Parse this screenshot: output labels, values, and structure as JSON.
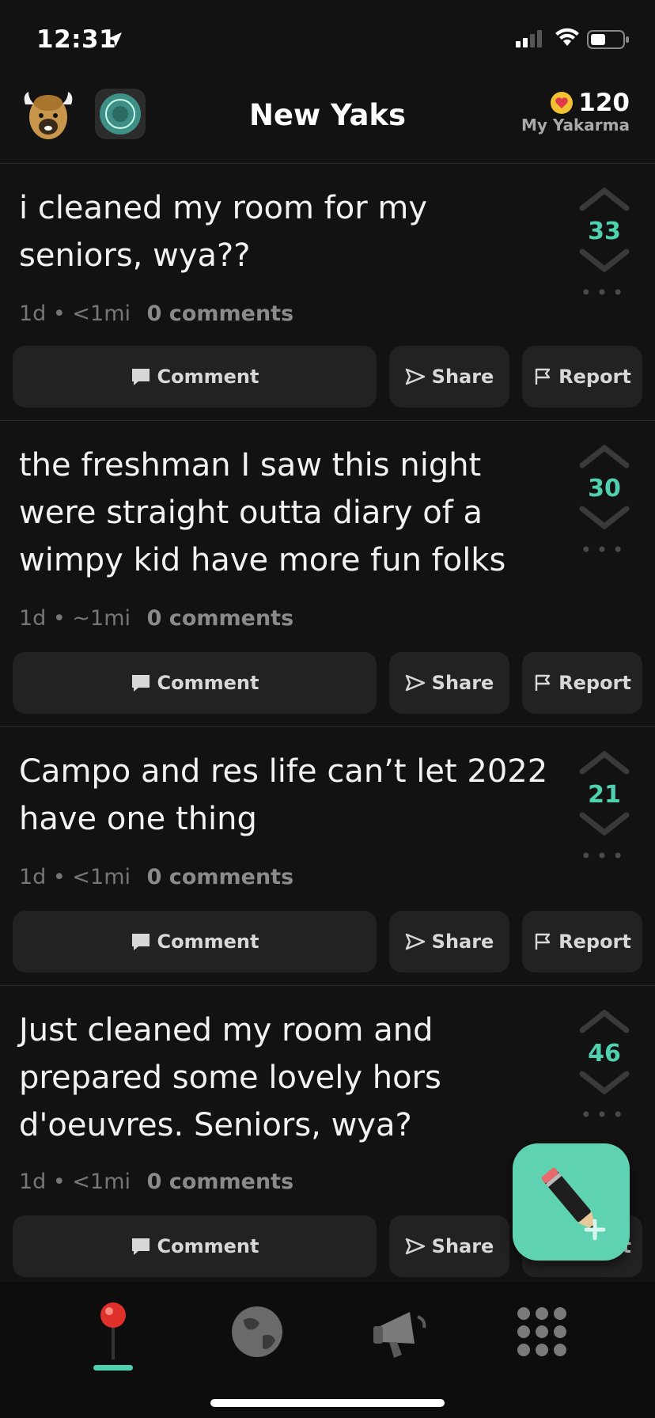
{
  "status": {
    "time": "12:31"
  },
  "header": {
    "title": "New Yaks",
    "yakarma_count": "120",
    "yakarma_label": "My Yakarma"
  },
  "posts": [
    {
      "text": "i cleaned my room for my seniors, wya??",
      "age": "1d",
      "distance": "<1mi",
      "comments": "0 comments",
      "votes": "33"
    },
    {
      "text": "the freshman I saw this night were straight outta diary of a wimpy kid have more fun folks",
      "age": "1d",
      "distance": "~1mi",
      "comments": "0 comments",
      "votes": "30"
    },
    {
      "text": "Campo and res life can’t let 2022 have one thing",
      "age": "1d",
      "distance": "<1mi",
      "comments": "0 comments",
      "votes": "21"
    },
    {
      "text": "Just cleaned my room and prepared some lovely hors d'oeuvres. Seniors, wya?",
      "age": "1d",
      "distance": "<1mi",
      "comments": "0 comments",
      "votes": "46"
    }
  ],
  "actions": {
    "comment": "Comment",
    "share": "Share",
    "report": "Report"
  },
  "colors": {
    "accent": "#4fd1b0",
    "fab": "#5fd3b1",
    "background": "#121212"
  },
  "icons": [
    "location-arrow-icon",
    "signal-icon",
    "wifi-icon",
    "battery-icon",
    "yak-avatar-icon",
    "spot-icon",
    "heart-icon",
    "upvote-icon",
    "downvote-icon",
    "more-icon",
    "comment-icon",
    "share-icon",
    "report-flag-icon",
    "pencil-plus-icon",
    "pin-icon",
    "globe-icon",
    "megaphone-icon",
    "grid-icon"
  ]
}
